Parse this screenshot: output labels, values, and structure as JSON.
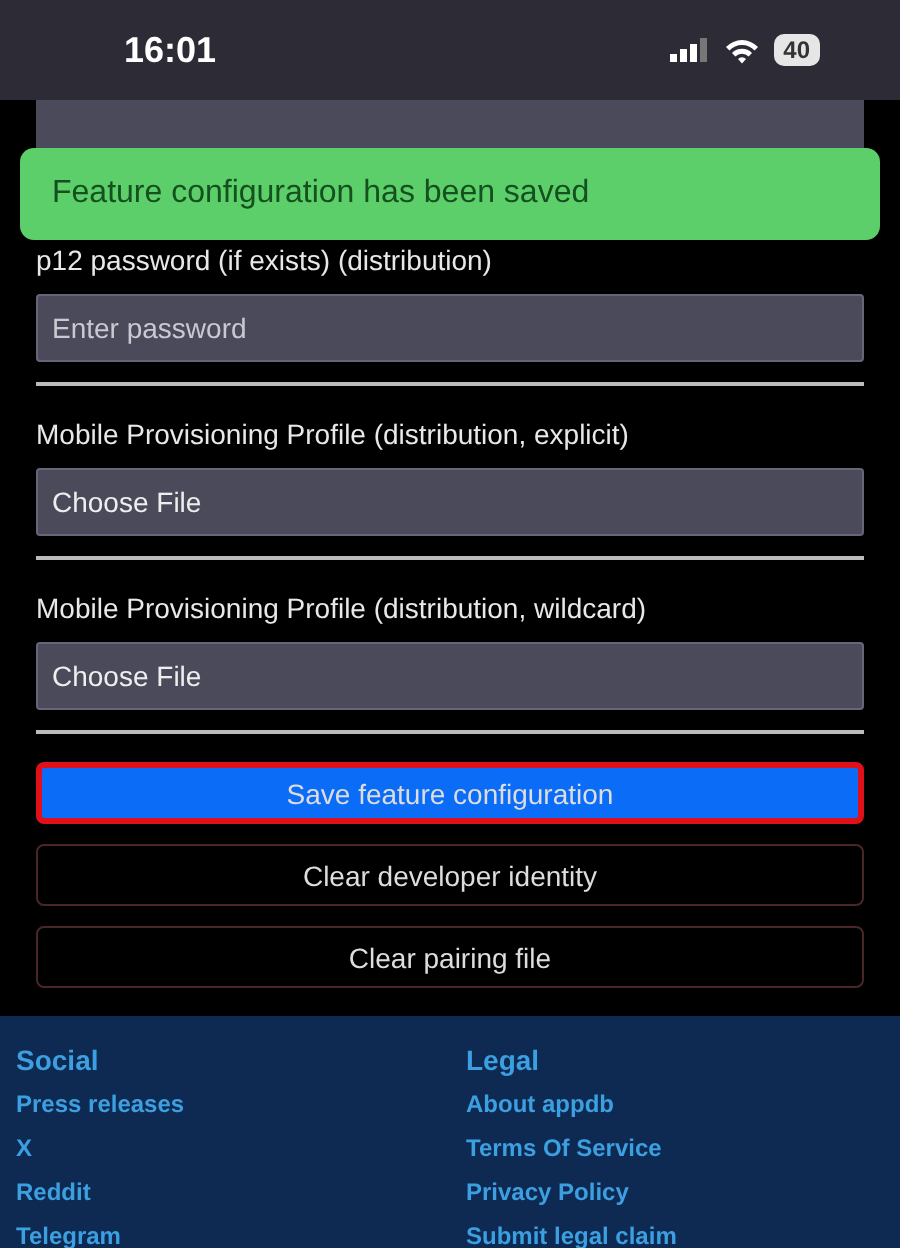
{
  "status_bar": {
    "time": "16:01",
    "battery": "40"
  },
  "toast": {
    "message": "Feature configuration has been saved"
  },
  "form": {
    "fields": [
      {
        "label": "p12 password (if exists) (distribution)",
        "kind": "text",
        "placeholder": "Enter password"
      },
      {
        "label": "Mobile Provisioning Profile (distribution, explicit)",
        "kind": "file",
        "value": "Choose File"
      },
      {
        "label": "Mobile Provisioning Profile (distribution, wildcard)",
        "kind": "file",
        "value": "Choose File"
      }
    ],
    "buttons": [
      {
        "label": "Save feature configuration",
        "kind": "primary",
        "highlighted": true
      },
      {
        "label": "Clear developer identity",
        "kind": "danger",
        "highlighted": false
      },
      {
        "label": "Clear pairing file",
        "kind": "danger",
        "highlighted": false
      }
    ]
  },
  "footer": {
    "columns": [
      {
        "heading": "Social",
        "links": [
          "Press releases",
          "X",
          "Reddit",
          "Telegram"
        ]
      },
      {
        "heading": "Legal",
        "links": [
          "About appdb",
          "Terms Of Service",
          "Privacy Policy",
          "Submit legal claim"
        ]
      }
    ]
  }
}
